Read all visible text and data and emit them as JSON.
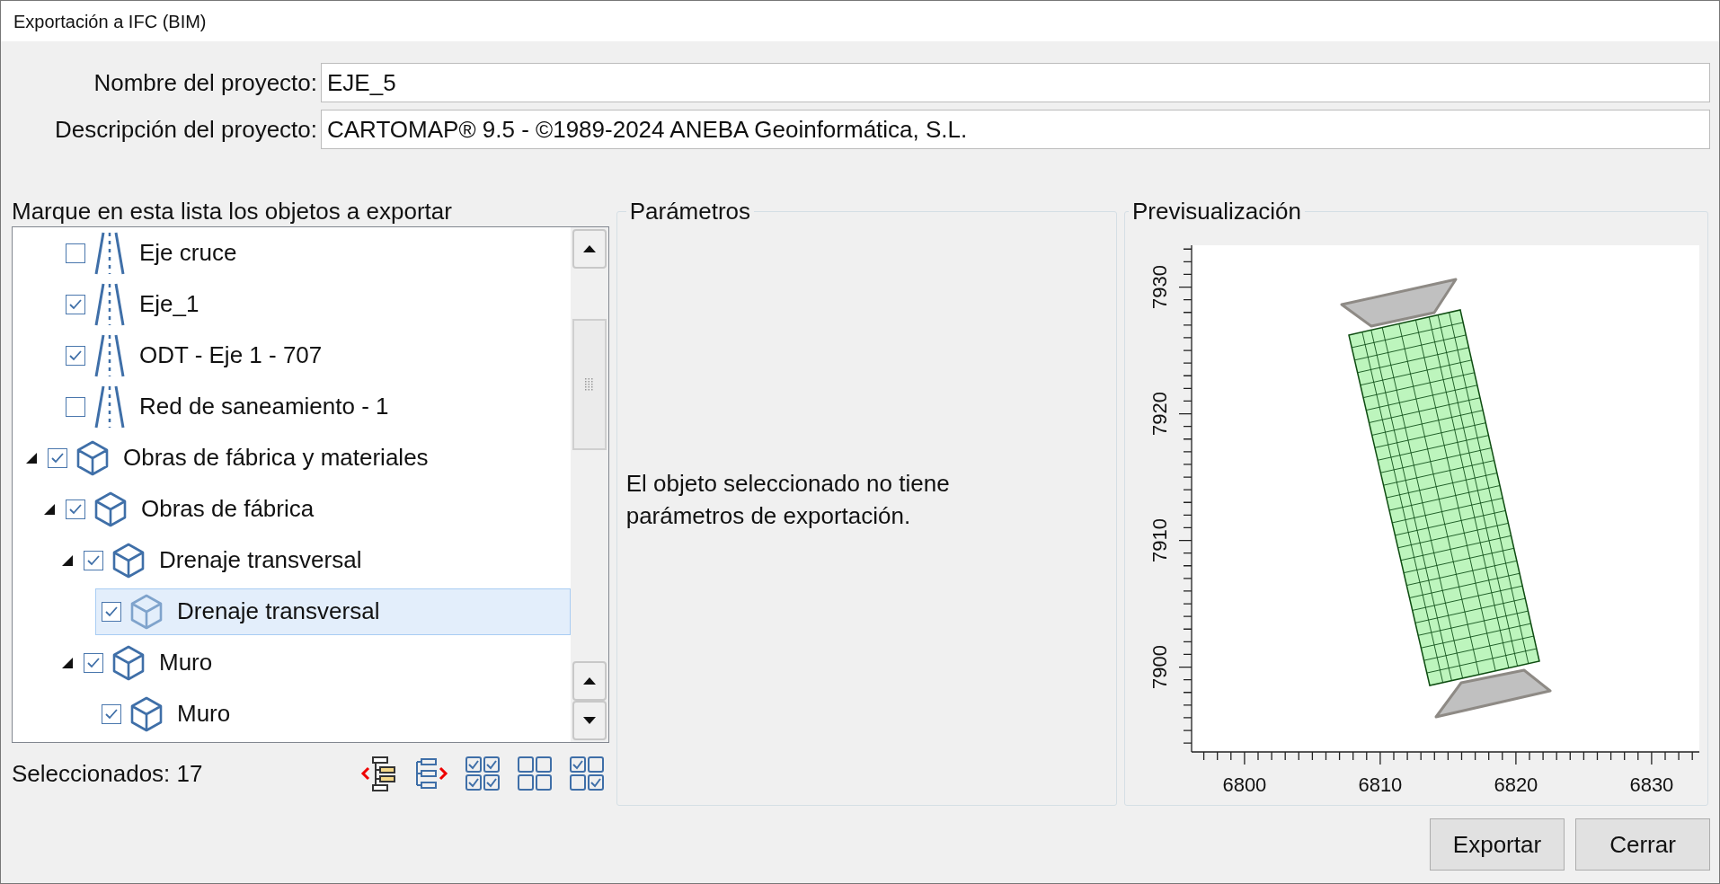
{
  "window": {
    "title": "Exportación a IFC (BIM)"
  },
  "project": {
    "name_label": "Nombre del proyecto:",
    "name": "EJE_5",
    "description_label": "Descripción del proyecto:",
    "description": "CARTOMAP® 9.5 - ©1989-2024 ANEBA Geoinformática, S.L."
  },
  "objects": {
    "heading": "Marque en esta lista los objetos a exportar",
    "selected_count": "Seleccionados: 17",
    "tree": [
      {
        "children": [
          {
            "label": "Eje cruce",
            "kind": "road",
            "checked": false,
            "selected": false
          },
          {
            "label": "Eje_1",
            "kind": "road",
            "checked": true,
            "selected": false
          },
          {
            "label": "ODT - Eje 1 - 707",
            "kind": "road",
            "checked": true,
            "selected": false
          },
          {
            "label": "Red de saneamiento - 1",
            "kind": "road",
            "checked": false,
            "selected": false
          }
        ]
      },
      {
        "label": "Obras de fábrica y materiales",
        "kind": "cube",
        "checked": true,
        "selected": false,
        "expanded": true,
        "children": [
          {
            "label": "Obras de fábrica",
            "kind": "cube",
            "checked": true,
            "selected": false,
            "expanded": true,
            "children": [
              {
                "label": "Drenaje transversal",
                "kind": "cube",
                "checked": true,
                "selected": false,
                "expanded": true,
                "children": [
                  {
                    "label": "Drenaje transversal",
                    "kind": "cube",
                    "checked": true,
                    "selected": true
                  }
                ]
              },
              {
                "label": "Muro",
                "kind": "cube",
                "checked": true,
                "selected": false,
                "expanded": true,
                "children": [
                  {
                    "label": "Muro",
                    "kind": "cube",
                    "checked": true,
                    "selected": false
                  }
                ]
              }
            ]
          }
        ]
      }
    ]
  },
  "parameters": {
    "title": "Parámetros",
    "message": "El objeto seleccionado no tiene parámetros de exportación."
  },
  "preview": {
    "title": "Previsualización",
    "y_labels": [
      "7930",
      "7920",
      "7910",
      "7900"
    ],
    "x_labels": [
      "6800",
      "6810",
      "6820",
      "6830"
    ]
  },
  "buttons": [
    "Exportar",
    "Cerrar"
  ]
}
